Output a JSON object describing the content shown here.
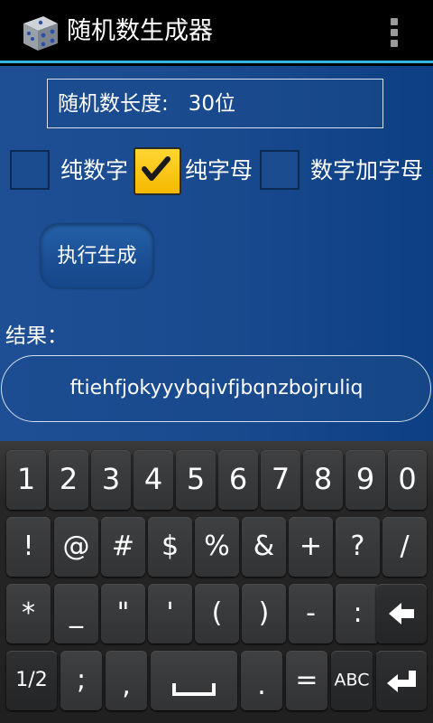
{
  "app": {
    "title": "随机数生成器"
  },
  "form": {
    "length_text": "随机数长度:   30位",
    "options": [
      {
        "label": "纯数字",
        "checked": false
      },
      {
        "label": "纯字母",
        "checked": true
      },
      {
        "label": "数字加字母",
        "checked": false
      }
    ],
    "generate_label": "执行生成",
    "result_label": "结果：",
    "result_value": "ftiehfjokyyybqivfjbqnzbojruliq"
  },
  "keyboard": {
    "row1": [
      "1",
      "2",
      "3",
      "4",
      "5",
      "6",
      "7",
      "8",
      "9",
      "0"
    ],
    "row2": [
      "!",
      "@",
      "#",
      "$",
      "%",
      "&",
      "+",
      "?",
      "/"
    ],
    "row3": [
      "*",
      "_",
      "\"",
      "'",
      "(",
      ")",
      "-",
      ":"
    ],
    "row4": {
      "page": "1/2",
      "semicolon": ";",
      "comma": ",",
      "period": ".",
      "equals": "=",
      "abc": "ABC"
    }
  },
  "colors": {
    "accent": "#33b5e5",
    "background": "#1a4a8d",
    "checkbox_checked": "#f5c400"
  }
}
